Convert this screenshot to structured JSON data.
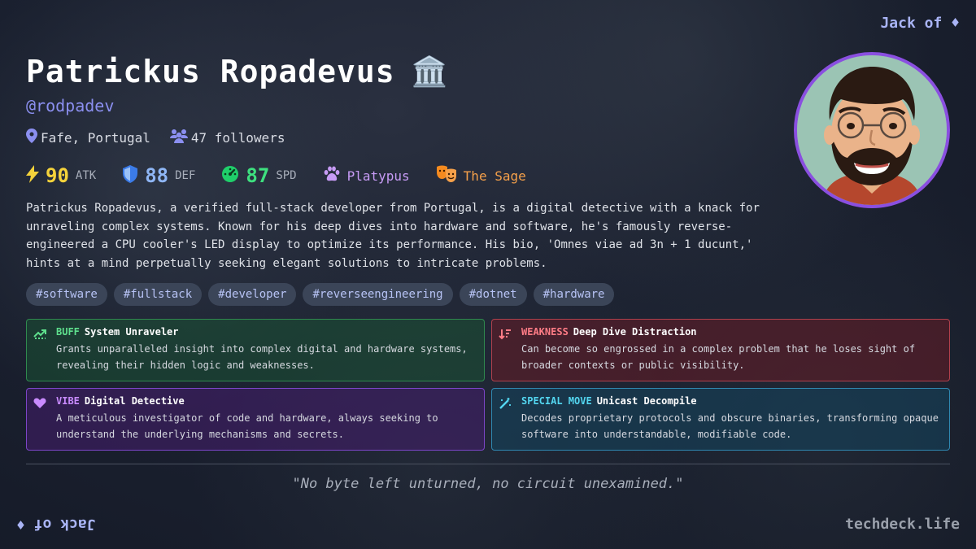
{
  "corner_label": "Jack of ♦",
  "site": "techdeck.life",
  "profile": {
    "name": "Patrickus Ropadevus",
    "name_emoji": "🏛️",
    "handle": "@rodpadev",
    "location": "Fafe, Portugal",
    "followers": "47 followers"
  },
  "stats": {
    "atk": {
      "value": "90",
      "label": "ATK",
      "color": "#f5d33b"
    },
    "def": {
      "value": "88",
      "label": "DEF",
      "color": "#8fb6f5"
    },
    "spd": {
      "value": "87",
      "label": "SPD",
      "color": "#3ee07f"
    },
    "spirit": {
      "label": "Platypus",
      "color": "#c79bf5"
    },
    "archetype": {
      "label": "The Sage",
      "color": "#f5a04a"
    }
  },
  "bio": "Patrickus Ropadevus, a verified full-stack developer from Portugal, is a digital detective with a knack for unraveling complex systems. Known for his deep dives into hardware and software, he's famously reverse-engineered a CPU cooler's LED display to optimize its performance. His bio, 'Omnes viae ad 3n + 1 ducunt,' hints at a mind perpetually seeking elegant solutions to intricate problems.",
  "tags": [
    "#software",
    "#fullstack",
    "#developer",
    "#reverseengineering",
    "#dotnet",
    "#hardware"
  ],
  "cards": {
    "buff": {
      "kind": "BUFF",
      "title": "System Unraveler",
      "desc": "Grants unparalleled insight into complex digital and hardware systems, revealing their hidden logic and weaknesses."
    },
    "weakness": {
      "kind": "WEAKNESS",
      "title": "Deep Dive Distraction",
      "desc": "Can become so engrossed in a complex problem that he loses sight of broader contexts or public visibility."
    },
    "vibe": {
      "kind": "VIBE",
      "title": "Digital Detective",
      "desc": "A meticulous investigator of code and hardware, always seeking to understand the underlying mechanisms and secrets."
    },
    "special": {
      "kind": "SPECIAL MOVE",
      "title": "Unicast Decompile",
      "desc": "Decodes proprietary protocols and obscure binaries, transforming opaque software into understandable, modifiable code."
    }
  },
  "quote": "\"No byte left unturned, no circuit unexamined.\""
}
